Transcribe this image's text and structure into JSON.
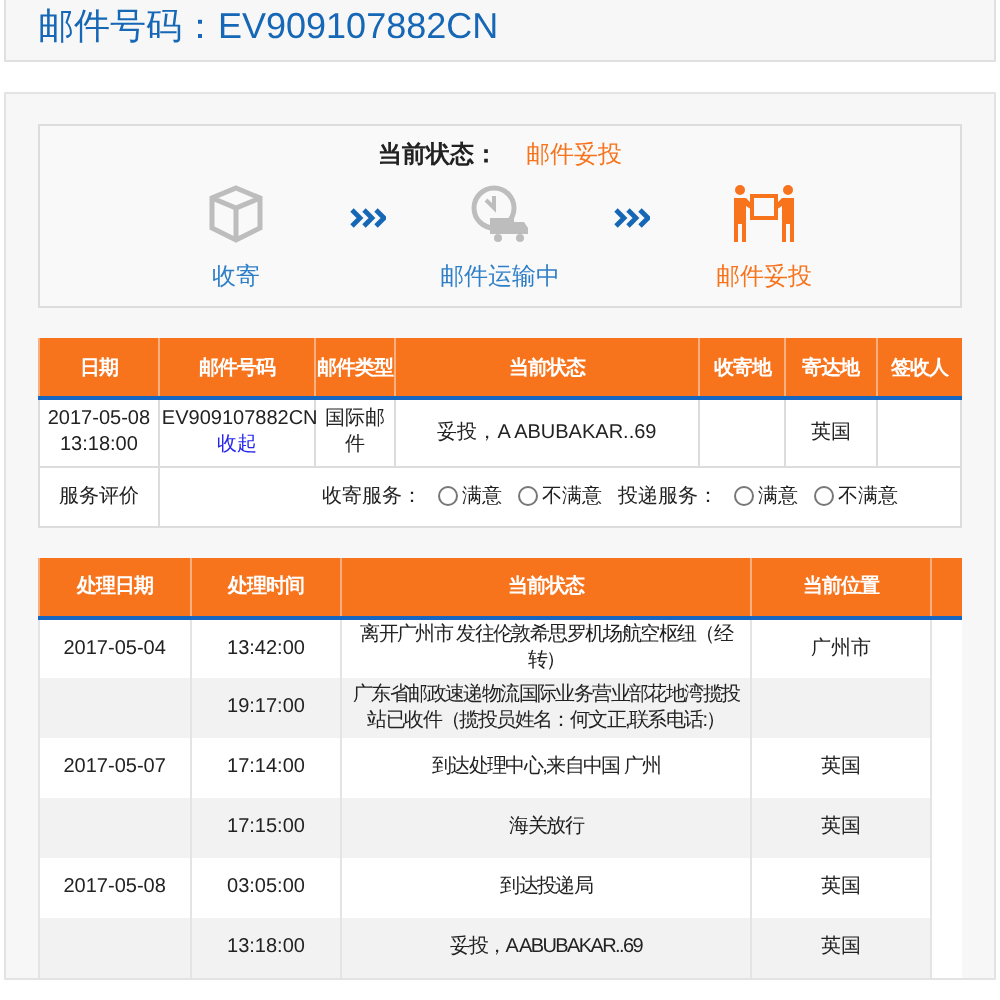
{
  "title": "邮件号码：EV909107882CN",
  "status": {
    "label": "当前状态：",
    "value": "邮件妥投"
  },
  "stages": [
    {
      "kind": "box",
      "label": "收寄",
      "selected": false
    },
    {
      "kind": "truck",
      "label": "邮件运输中",
      "selected": false
    },
    {
      "kind": "delivery",
      "label": "邮件妥投",
      "selected": true
    }
  ],
  "summary": {
    "columns": [
      "日期",
      "邮件号码",
      "邮件类型",
      "当前状态",
      "收寄地",
      "寄达地",
      "签收人"
    ],
    "row": {
      "date": "2017-05-08 13:18:00",
      "mail_number": "EV909107882CN",
      "toggle_link": "收起",
      "mail_type": "国际邮件",
      "status": "妥投，A ABUBAKAR..69",
      "destination": "英国"
    },
    "rating": {
      "label": "服务评价",
      "groups": [
        {
          "label": "收寄服务：",
          "options": [
            {
              "label": "满意",
              "checked": false
            },
            {
              "label": "不满意",
              "checked": false
            }
          ]
        },
        {
          "label": "投递服务：",
          "options": [
            {
              "label": "满意",
              "checked": false
            },
            {
              "label": "不满意",
              "checked": false
            }
          ]
        }
      ]
    }
  },
  "history": {
    "columns": [
      "处理日期",
      "处理时间",
      "当前状态",
      "当前位置"
    ],
    "rows": [
      {
        "date": "2017-05-04",
        "time": "13:42:00",
        "status": "离开广州市 发往伦敦希思罗机场航空枢纽（经转）",
        "location": "广州市"
      },
      {
        "time": "19:17:00",
        "status": "广东省邮政速递物流国际业务营业部花地湾揽投站已收件（揽投员姓名：何文正,联系电话:）"
      },
      {
        "date": "2017-05-07",
        "time": "17:14:00",
        "status": "到达处理中心,来自中国 广州",
        "location": "英国"
      },
      {
        "time": "17:15:00",
        "status": "海关放行",
        "location": "英国"
      },
      {
        "date": "2017-05-08",
        "time": "03:05:00",
        "status": "到达投递局",
        "location": "英国"
      },
      {
        "time": "13:18:00",
        "status": "妥投，A ABUBAKAR..69",
        "location": "英国"
      }
    ]
  }
}
